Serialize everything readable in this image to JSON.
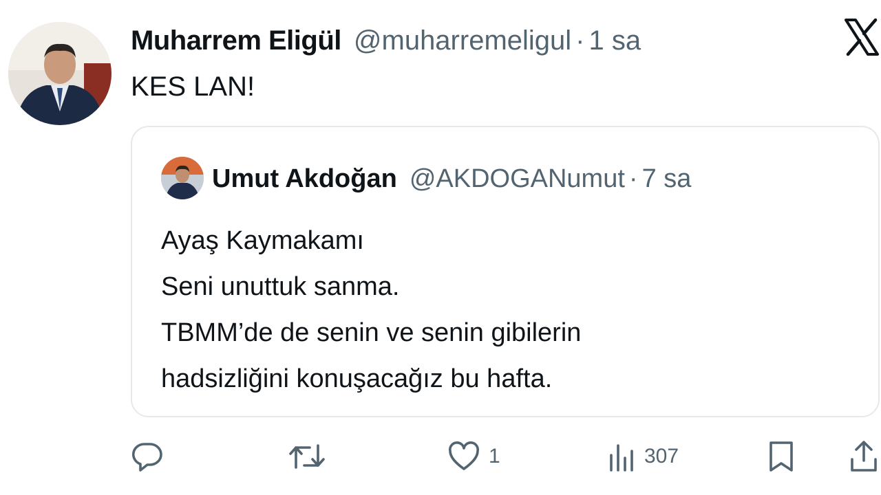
{
  "tweet": {
    "display_name": "Muharrem Eligül",
    "handle": "@muharremeligul",
    "separator": "·",
    "time": "1 sa",
    "text": "KES LAN!",
    "avatar_icon": "profile-photo"
  },
  "quoted": {
    "display_name": "Umut Akdoğan",
    "handle": "@AKDOGANumut",
    "separator": "·",
    "time": "7 sa",
    "lines": [
      "Ayaş Kaymakamı",
      "Seni unuttuk sanma.",
      "TBMM’de de senin ve senin gibilerin",
      "hadsizliğini konuşacağız bu hafta."
    ]
  },
  "actions": {
    "reply": {
      "icon": "reply-icon"
    },
    "retweet": {
      "icon": "retweet-icon"
    },
    "like": {
      "icon": "heart-icon",
      "count": "1"
    },
    "views": {
      "icon": "views-icon",
      "count": "307"
    },
    "bookmark": {
      "icon": "bookmark-icon"
    },
    "share": {
      "icon": "share-icon"
    }
  },
  "brand": {
    "logo": "x-logo-icon",
    "color": "#0f1419",
    "secondary_text": "#536471"
  }
}
